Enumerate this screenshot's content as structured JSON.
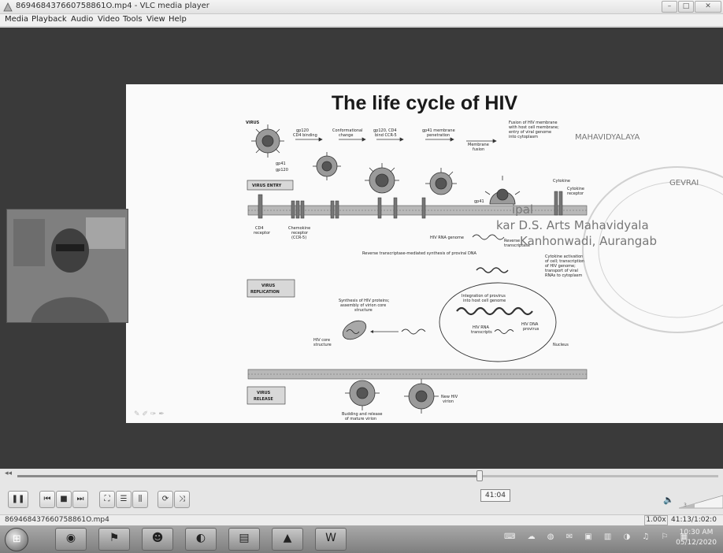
{
  "window": {
    "title": "869468437660758861O.mp4 - VLC media player",
    "minimize_icon": "minimize-icon",
    "maximize_icon": "maximize-icon",
    "close_icon": "close-icon"
  },
  "menu": [
    "Media",
    "Playback",
    "Audio",
    "Video",
    "Tools",
    "View",
    "Help"
  ],
  "slide": {
    "title": "The life cycle of HIV",
    "labels": {
      "virus": "VIRUS",
      "gp120_cd4": "gp120\nCD4 binding",
      "conformational": "Conformational\nchange",
      "gp120_cd4_ccr5": "gp120, CD4\nbind CCR-5",
      "gp41": "gp41 membrane\npenetration",
      "membrane_fusion": "Membrane\nfusion",
      "fusion": "Fusion of HIV membrane\nwith host cell membrane;\nentry of viral genome\ninto cytoplasm",
      "gp41_small": "gp41",
      "gp120_small": "gp120",
      "virus_entry": "VIRUS ENTRY",
      "cytokine": "Cytokine",
      "cytokine_receptor": "Cytokine\nreceptor",
      "cd4_receptor": "CD4\nreceptor",
      "chemokine_receptor": "Chemokine\nreceptor\n(CCR-5)",
      "hiv_rna_genome": "HIV RNA genome",
      "reverse_transcriptase": "Reverse\ntranscriptase",
      "rt_synthesis": "Reverse transcriptase-mediated synthesis of proviral DNA",
      "cytokine_activation": "Cytokine activation\nof cell; transcription\nof HIV genome;\ntransport of viral\nRNAs to cytoplasm",
      "virus_replication": "VIRUS\nREPLICATION",
      "integration": "Integration of provirus\ninto host cell genome",
      "synthesis": "Synthesis of HIV proteins;\nassembly of virion core\nstructure",
      "hiv_core": "HIV core\nstructure",
      "hiv_rna_transcripts": "HIV RNA\ntranscripts",
      "hiv_dna_provirus": "HIV DNA\nprovirus",
      "nucleus": "Nucleus",
      "virus_release": "VIRUS\nRELEASE",
      "budding": "Budding and release\nof mature virion",
      "new_hiv": "New HIV\nvirion"
    },
    "watermark": {
      "line1": "ipal",
      "line2": "kar D.S. Arts Mahavidyala",
      "line3": "Kanhonwadi, Aurangab",
      "ring_top": "MAHAVIDYALAYA",
      "ring_side": "GEVRAI"
    },
    "footer_mark": "✎ ✐ ✑ ✒"
  },
  "webcam": {
    "icon": "presenter-webcam"
  },
  "player": {
    "progress": 0.66,
    "time_tooltip": "41:04",
    "play_icon": "pause-icon",
    "buttons": [
      {
        "name": "previous-button",
        "icon": "previous-icon",
        "glyph": "⏮"
      },
      {
        "name": "stop-button",
        "icon": "stop-icon",
        "glyph": "■"
      },
      {
        "name": "next-button",
        "icon": "next-icon",
        "glyph": "⏭"
      },
      {
        "name": "fullscreen-button",
        "icon": "fullscreen-icon",
        "glyph": "⛶"
      },
      {
        "name": "playlist-button",
        "icon": "playlist-icon",
        "glyph": "☰"
      },
      {
        "name": "extended-settings-button",
        "icon": "equalizer-icon",
        "glyph": "⫼"
      },
      {
        "name": "loop-button",
        "icon": "loop-icon",
        "glyph": "⟳"
      },
      {
        "name": "shuffle-button",
        "icon": "shuffle-icon",
        "glyph": "⤨"
      }
    ],
    "volume_icon": "speaker-icon",
    "volume_level": "3"
  },
  "status": {
    "file": "869468437660758861O.mp4",
    "speed": "1.00x",
    "time": "41:13/1:02:0"
  },
  "taskbar": {
    "items": [
      {
        "name": "taskbar-browser",
        "icon": "browser-icon",
        "glyph": "◉"
      },
      {
        "name": "taskbar-acrobat",
        "icon": "acrobat-icon",
        "glyph": "⚑"
      },
      {
        "name": "taskbar-media-player",
        "icon": "media-player-icon",
        "glyph": "☻"
      },
      {
        "name": "taskbar-chrome",
        "icon": "chrome-icon",
        "glyph": "◐"
      },
      {
        "name": "taskbar-explorer",
        "icon": "folder-icon",
        "glyph": "▤"
      },
      {
        "name": "taskbar-vlc",
        "icon": "vlc-icon",
        "glyph": "▲"
      },
      {
        "name": "taskbar-word",
        "icon": "word-icon",
        "glyph": "W"
      }
    ],
    "tray": "⌨ ☁ ◍ ✉ ▣ ▥ ◑ ♫ ⚐ ▦",
    "clock_time": "10:30 AM",
    "clock_date": "05/12/2020"
  }
}
